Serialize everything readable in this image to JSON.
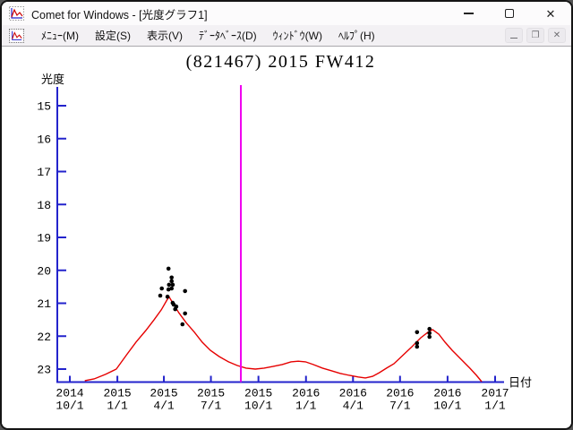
{
  "window": {
    "title": "Comet for Windows - [光度グラフ1]"
  },
  "menu": {
    "items": [
      {
        "id": "menu",
        "label": "ﾒﾆｭｰ(M)"
      },
      {
        "id": "settings",
        "label": "設定(S)"
      },
      {
        "id": "view",
        "label": "表示(V)"
      },
      {
        "id": "database",
        "label": "ﾃﾞｰﾀﾍﾞｰｽ(D)"
      },
      {
        "id": "window",
        "label": "ｳｨﾝﾄﾞｳ(W)"
      },
      {
        "id": "help",
        "label": "ﾍﾙﾌﾟ(H)"
      }
    ]
  },
  "icons": {
    "app_icon": "light-curve-chart-icon",
    "titlebar": [
      "minimize-icon",
      "maximize-icon",
      "close-icon"
    ],
    "mdi": [
      "mdi-minimize-icon",
      "mdi-restore-icon",
      "mdi-close-icon"
    ],
    "close_glyph": "✕",
    "mdi_restore_glyph": "❐"
  },
  "chart_data": {
    "type": "scatter+line",
    "title": "(821467) 2015 FW412",
    "xlabel": "日付",
    "ylabel": "光度",
    "colors": {
      "axis": "#2323cc",
      "curve": "#e60000",
      "points": "#000000",
      "marker_line": "#f000f0",
      "text": "#000000"
    },
    "y_axis": {
      "label": "光度",
      "ticks": [
        15,
        16,
        17,
        18,
        19,
        20,
        21,
        22,
        23
      ],
      "min": 15,
      "max": 23,
      "inverted": true
    },
    "x_axis": {
      "label": "日付",
      "unit": "days since 2014-10-01",
      "range_days": [
        0,
        823
      ],
      "ticks": [
        {
          "d": 0,
          "line1": "2014",
          "line2": "10/1"
        },
        {
          "d": 92,
          "line1": "2015",
          "line2": "1/1"
        },
        {
          "d": 182,
          "line1": "2015",
          "line2": "4/1"
        },
        {
          "d": 273,
          "line1": "2015",
          "line2": "7/1"
        },
        {
          "d": 365,
          "line1": "2015",
          "line2": "10/1"
        },
        {
          "d": 457,
          "line1": "2016",
          "line2": "1/1"
        },
        {
          "d": 548,
          "line1": "2016",
          "line2": "4/1"
        },
        {
          "d": 639,
          "line1": "2016",
          "line2": "7/1"
        },
        {
          "d": 731,
          "line1": "2016",
          "line2": "10/1"
        },
        {
          "d": 823,
          "line1": "2017",
          "line2": "1/1"
        }
      ]
    },
    "marker_line": {
      "d": 331,
      "note": "vertical magenta line"
    },
    "curve": [
      [
        29,
        23.35
      ],
      [
        47,
        23.3
      ],
      [
        69,
        23.16
      ],
      [
        90,
        23.0
      ],
      [
        111,
        22.54
      ],
      [
        128,
        22.18
      ],
      [
        147,
        21.83
      ],
      [
        163,
        21.5
      ],
      [
        177,
        21.2
      ],
      [
        187,
        20.93
      ],
      [
        192,
        20.8
      ],
      [
        199,
        20.99
      ],
      [
        211,
        21.29
      ],
      [
        225,
        21.59
      ],
      [
        241,
        21.88
      ],
      [
        256,
        22.18
      ],
      [
        272,
        22.43
      ],
      [
        289,
        22.62
      ],
      [
        307,
        22.78
      ],
      [
        324,
        22.89
      ],
      [
        341,
        22.97
      ],
      [
        359,
        23.0
      ],
      [
        376,
        22.97
      ],
      [
        393,
        22.92
      ],
      [
        411,
        22.86
      ],
      [
        428,
        22.78
      ],
      [
        442,
        22.76
      ],
      [
        456,
        22.78
      ],
      [
        471,
        22.86
      ],
      [
        489,
        22.97
      ],
      [
        506,
        23.05
      ],
      [
        523,
        23.13
      ],
      [
        541,
        23.19
      ],
      [
        558,
        23.24
      ],
      [
        572,
        23.27
      ],
      [
        586,
        23.22
      ],
      [
        599,
        23.11
      ],
      [
        613,
        22.97
      ],
      [
        627,
        22.84
      ],
      [
        644,
        22.59
      ],
      [
        662,
        22.32
      ],
      [
        679,
        22.05
      ],
      [
        693,
        21.88
      ],
      [
        702,
        21.8
      ],
      [
        714,
        21.94
      ],
      [
        726,
        22.18
      ],
      [
        740,
        22.43
      ],
      [
        757,
        22.7
      ],
      [
        774,
        22.97
      ],
      [
        787,
        23.19
      ],
      [
        797,
        23.38
      ]
    ],
    "observations": [
      [
        191,
        19.95
      ],
      [
        197,
        20.22
      ],
      [
        197,
        20.33
      ],
      [
        192,
        20.44
      ],
      [
        199,
        20.44
      ],
      [
        178,
        20.55
      ],
      [
        191,
        20.58
      ],
      [
        197,
        20.55
      ],
      [
        223,
        20.63
      ],
      [
        175,
        20.77
      ],
      [
        189,
        20.8
      ],
      [
        199,
        20.99
      ],
      [
        201,
        21.04
      ],
      [
        206,
        21.1
      ],
      [
        204,
        21.18
      ],
      [
        223,
        21.31
      ],
      [
        218,
        21.64
      ],
      [
        672,
        21.88
      ],
      [
        672,
        22.21
      ],
      [
        672,
        22.32
      ],
      [
        696,
        21.78
      ],
      [
        696,
        21.91
      ],
      [
        696,
        22.02
      ]
    ]
  }
}
